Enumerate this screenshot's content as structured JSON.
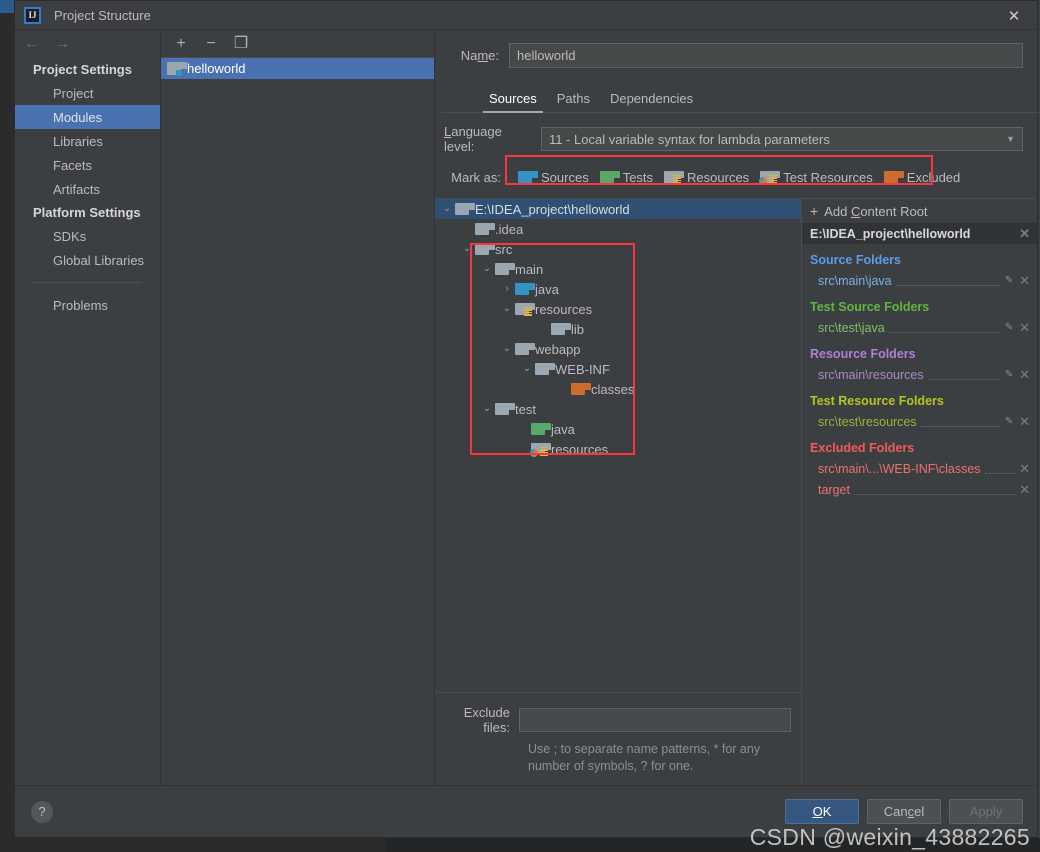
{
  "window": {
    "title": "Project Structure",
    "logo_text": "IJ",
    "close_label": "✕"
  },
  "sidebar": {
    "back_icon": "←",
    "forward_icon": "→",
    "groups": [
      {
        "title": "Project Settings",
        "items": [
          {
            "label": "Project",
            "selected": false
          },
          {
            "label": "Modules",
            "selected": true
          },
          {
            "label": "Libraries",
            "selected": false
          },
          {
            "label": "Facets",
            "selected": false
          },
          {
            "label": "Artifacts",
            "selected": false
          }
        ]
      },
      {
        "title": "Platform Settings",
        "items": [
          {
            "label": "SDKs",
            "selected": false
          },
          {
            "label": "Global Libraries",
            "selected": false
          }
        ]
      }
    ],
    "problems": {
      "label": "Problems"
    }
  },
  "modules": {
    "toolbar": {
      "add": "+",
      "remove": "−",
      "copy": "❐"
    },
    "items": [
      {
        "label": "helloworld",
        "selected": true,
        "icon": "module-folder-icon"
      }
    ]
  },
  "main": {
    "name": {
      "label": "Name:",
      "label_pre": "Na",
      "label_key": "m",
      "label_post": "e:",
      "value": "helloworld"
    },
    "tabs": [
      {
        "label": "Sources",
        "active": true
      },
      {
        "label": "Paths",
        "active": false
      },
      {
        "label": "Dependencies",
        "active": false
      }
    ],
    "language_level": {
      "label_pre": "",
      "label_key": "L",
      "label_post": "anguage level:",
      "value": "11 - Local variable syntax for lambda parameters",
      "caret": "▼"
    },
    "mark_as": {
      "label": "Mark as:",
      "buttons": [
        {
          "label": "Sources",
          "icon": "folder-blue-icon",
          "color": "blue"
        },
        {
          "label": "Tests",
          "icon": "folder-green-icon",
          "color": "green"
        },
        {
          "label": "Resources",
          "icon": "folder-resources-icon",
          "color": "gray"
        },
        {
          "label": "Test Resources",
          "icon": "folder-test-resources-icon",
          "color": "gray"
        },
        {
          "label": "Excluded",
          "icon": "folder-orange-icon",
          "color": "orange"
        }
      ]
    },
    "tree": [
      {
        "label": "E:\\IDEA_project\\helloworld",
        "depth": 0,
        "twisty": "⌄",
        "icon": "gray",
        "selected": true
      },
      {
        "label": ".idea",
        "depth": 1,
        "twisty": "",
        "icon": "gray",
        "selected": false
      },
      {
        "label": "src",
        "depth": 1,
        "twisty": "⌄",
        "icon": "gray",
        "selected": false
      },
      {
        "label": "main",
        "depth": 2,
        "twisty": "⌄",
        "icon": "gray",
        "selected": false
      },
      {
        "label": "java",
        "depth": 3,
        "twisty": "›",
        "icon": "blue",
        "selected": false
      },
      {
        "label": "resources",
        "depth": 3,
        "twisty": "⌄",
        "icon": "gray-res",
        "selected": false
      },
      {
        "label": "lib",
        "depth": 4,
        "twisty": "",
        "icon": "gray",
        "selected": false
      },
      {
        "label": "webapp",
        "depth": 3,
        "twisty": "⌄",
        "icon": "gray",
        "selected": false
      },
      {
        "label": "WEB-INF",
        "depth": 4,
        "twisty": "⌄",
        "icon": "gray",
        "selected": false
      },
      {
        "label": "classes",
        "depth": 5,
        "twisty": "",
        "icon": "orange",
        "selected": false
      },
      {
        "label": "test",
        "depth": 2,
        "twisty": "⌄",
        "icon": "gray",
        "selected": false
      },
      {
        "label": "java",
        "depth": 3,
        "twisty": "",
        "icon": "green",
        "selected": false
      },
      {
        "label": "resources",
        "depth": 3,
        "twisty": "",
        "icon": "gray-testres",
        "selected": false
      }
    ],
    "exclude_files": {
      "label": "Exclude files:",
      "value": "",
      "hint": "Use ; to separate name patterns, * for any number of symbols, ? for one."
    }
  },
  "info_panel": {
    "add_content_root": {
      "plus": "+",
      "label_pre": "Add ",
      "label_key": "C",
      "label_post": "ontent Root"
    },
    "content_root": {
      "path": "E:\\IDEA_project\\helloworld",
      "close": "✕"
    },
    "groups": [
      {
        "title": "Source Folders",
        "color_class": "c-src",
        "item_color_class": "c-srcp",
        "items": [
          {
            "path": "src\\main\\java",
            "editable": true,
            "close": "✕",
            "pencil": "✎"
          }
        ]
      },
      {
        "title": "Test Source Folders",
        "color_class": "c-test",
        "item_color_class": "c-testp",
        "items": [
          {
            "path": "src\\test\\java",
            "editable": true,
            "close": "✕",
            "pencil": "✎"
          }
        ]
      },
      {
        "title": "Resource Folders",
        "color_class": "c-res",
        "item_color_class": "c-resp",
        "items": [
          {
            "path": "src\\main\\resources",
            "editable": true,
            "close": "✕",
            "pencil": "✎"
          }
        ]
      },
      {
        "title": "Test Resource Folders",
        "color_class": "c-tres",
        "item_color_class": "c-tresp",
        "items": [
          {
            "path": "src\\test\\resources",
            "editable": true,
            "close": "✕",
            "pencil": "✎"
          }
        ]
      },
      {
        "title": "Excluded Folders",
        "color_class": "c-exc",
        "item_color_class": "c-excp",
        "items": [
          {
            "path": "src\\main\\...\\WEB-INF\\classes",
            "editable": false,
            "close": "✕",
            "pencil": ""
          },
          {
            "path": "target",
            "editable": false,
            "close": "✕",
            "pencil": ""
          }
        ]
      }
    ]
  },
  "footer": {
    "help": "?",
    "buttons": [
      {
        "label": "OK",
        "style": "primary"
      },
      {
        "label": "Cancel",
        "style": "normal"
      },
      {
        "label": "Apply",
        "style": "disabled"
      }
    ]
  },
  "watermark": {
    "text": "CSDN @weixin_43882265"
  },
  "colors": {
    "accent_blue": "#4a72b0",
    "selection_tree": "#2f4f73",
    "highlight_red": "#fb3640",
    "panel_bg": "#3c3f41",
    "primary_button": "#365880"
  }
}
